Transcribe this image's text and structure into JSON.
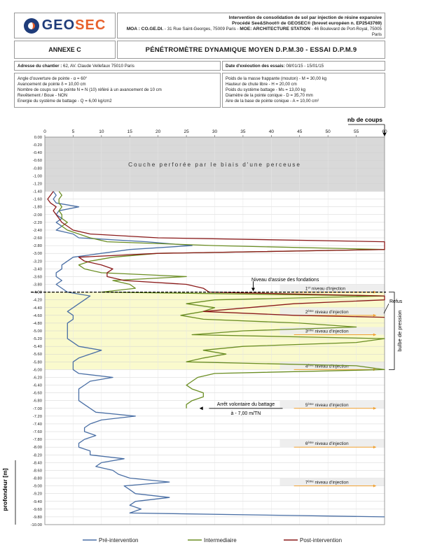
{
  "header": {
    "logo_text_1": "GEO",
    "logo_text_2": "SEC",
    "line1": "Intervention de consolidation de sol par injection de résine expansive",
    "line2": "Procédé See&Shoot® de GEOSEC® (brevet européen n. EP2543769)",
    "moa_label": "MOA : CO.GE.DI.",
    "moa_address": " - 31 Rue Saint-Georges, 75009 Paris - ",
    "moe_label": "MOE: ARCHITECTURE STATION",
    "moe_address": " - 46 Boulevard de Port-Royal, 75005 Paris"
  },
  "annexe": "ANNEXE C",
  "title": "PÉNÉTROMÈTRE DYNAMIQUE MOYEN D.P.M.30 - ESSAI D.P.M.9",
  "address_label": "Adresse du chantier :",
  "address_value": " 62, AV. Claude Vellefaux 75010 Paris",
  "date_label": "Date d'exéoution des essais:",
  "date_value": " 08/01/15 - 15/01/15",
  "params_left": [
    "Angle d'ouverture de pointe - α = 60°",
    "Avancement de pointe δ = 10,00 cm",
    "Nombre de coups sur la pointe N = N (10) référé à un avancement de 10 cm",
    "Revêtement / Boue - NON",
    "Energie du système de battage - Q = 6,00 kg/cm2"
  ],
  "params_right": [
    "Poids de la masse frappante (mouton) - M = 30,00 kg",
    "Hauteur de chute libre - H = 20,00 cm",
    "Poids du système battage - Ms = 13,00 kg",
    "Diamètre de la pointe conique - D = 35,70 mm",
    "Aire de la base de pointe conique - A = 10,00 cm²"
  ],
  "colors": {
    "pre": "#4a6fa5",
    "intermediaire": "#6b8e23",
    "post": "#8b1a1a",
    "zone_gray": "#d9d9d9",
    "bulb": "#fafacd",
    "arrow_orange": "#f0a030"
  },
  "chart_data": {
    "type": "line",
    "orientation": "vertical-depth",
    "xlabel": "nb de coups",
    "ylabel": "profondeur [m]",
    "xlim": [
      0,
      60
    ],
    "ylim": [
      0,
      -10
    ],
    "x_ticks": [
      0,
      5,
      10,
      15,
      20,
      25,
      30,
      35,
      40,
      45,
      50,
      55,
      60
    ],
    "y_ticks": [
      "0.00",
      "-0.20",
      "-0.40",
      "-0.60",
      "-0.80",
      "-1.00",
      "-1.20",
      "-1.40",
      "-1.60",
      "-1.80",
      "-2.00",
      "-2.20",
      "-2.40",
      "-2.60",
      "-2.80",
      "-3.00",
      "-3.20",
      "-3.40",
      "-3.60",
      "-3.80",
      "-4.00",
      "-4.20",
      "-4.40",
      "-4.60",
      "-4.80",
      "-5.00",
      "-5.20",
      "-5.40",
      "-5.60",
      "-5.80",
      "-6.00",
      "-6.20",
      "-6.40",
      "-6.60",
      "-6.80",
      "-7.00",
      "-7.20",
      "-7.40",
      "-7.60",
      "-7.80",
      "-8.00",
      "-8.20",
      "-8.40",
      "-8.60",
      "-8.80",
      "-9.00",
      "-9.20",
      "-9.40",
      "-9.60",
      "-9.80",
      "-10.00"
    ],
    "grid": true,
    "legend_position": "bottom",
    "perforated_zone": {
      "from": 0,
      "to": -1.4,
      "label": "Couche perforée par le biais d'une perceuse"
    },
    "bulb_zone": {
      "from": -4.0,
      "to": -6.0,
      "label": "bulbe de pression"
    },
    "foundation": {
      "depth": -4.0,
      "label": "Niveau d'assise des fondations"
    },
    "refus_label": "Refus",
    "stop_annotation": {
      "line1": "Arrêt volontaire du battage",
      "line2": "à - 7,00 m/TN",
      "depth": -7.0
    },
    "injection_levels": [
      {
        "sup": "1",
        "suffix": "er",
        "text": " niveau d'injection",
        "depth": -4.0
      },
      {
        "sup": "2",
        "suffix": "ème",
        "text": " niveau d'injection",
        "depth": -4.6
      },
      {
        "sup": "3",
        "suffix": "ème",
        "text": " niveau d'injection",
        "depth": -5.1
      },
      {
        "sup": "4",
        "suffix": "ème",
        "text": " niveau d'injection",
        "depth": -6.0
      },
      {
        "sup": "5",
        "suffix": "ème",
        "text": " niveau d'injection",
        "depth": -7.0
      },
      {
        "sup": "6",
        "suffix": "ème",
        "text": " niveau d'injection",
        "depth": -8.0
      },
      {
        "sup": "7",
        "suffix": "ème",
        "text": " niveau d'injection",
        "depth": -9.0
      }
    ],
    "series": [
      {
        "name": "Pré-intervention",
        "points": [
          [
            1.5,
            -1.4
          ],
          [
            2,
            -1.5
          ],
          [
            1.5,
            -1.6
          ],
          [
            2,
            -1.7
          ],
          [
            6,
            -1.8
          ],
          [
            2.5,
            -1.9
          ],
          [
            2,
            -2.0
          ],
          [
            3,
            -2.1
          ],
          [
            2,
            -2.2
          ],
          [
            3,
            -2.3
          ],
          [
            2,
            -2.4
          ],
          [
            5,
            -2.5
          ],
          [
            6,
            -2.6
          ],
          [
            18,
            -2.7
          ],
          [
            26,
            -2.8
          ],
          [
            15,
            -2.9
          ],
          [
            10,
            -3.0
          ],
          [
            5,
            -3.1
          ],
          [
            4,
            -3.2
          ],
          [
            3,
            -3.3
          ],
          [
            3,
            -3.4
          ],
          [
            2,
            -3.5
          ],
          [
            2,
            -3.6
          ],
          [
            3,
            -3.7
          ],
          [
            2,
            -3.8
          ],
          [
            3,
            -3.9
          ],
          [
            4,
            -4.0
          ],
          [
            8,
            -4.1
          ],
          [
            7,
            -4.2
          ],
          [
            6,
            -4.3
          ],
          [
            5,
            -4.4
          ],
          [
            4,
            -4.5
          ],
          [
            5,
            -4.6
          ],
          [
            5,
            -4.7
          ],
          [
            4,
            -4.8
          ],
          [
            4,
            -4.9
          ],
          [
            4,
            -5.0
          ],
          [
            4,
            -5.1
          ],
          [
            4,
            -5.2
          ],
          [
            5,
            -5.3
          ],
          [
            6,
            -5.4
          ],
          [
            10,
            -5.5
          ],
          [
            8,
            -5.6
          ],
          [
            6,
            -5.7
          ],
          [
            5,
            -5.8
          ],
          [
            5,
            -5.9
          ],
          [
            5,
            -6.0
          ],
          [
            6,
            -6.1
          ],
          [
            12,
            -6.2
          ],
          [
            8,
            -6.3
          ],
          [
            7,
            -6.4
          ],
          [
            6,
            -6.5
          ],
          [
            6,
            -6.6
          ],
          [
            6,
            -6.7
          ],
          [
            6,
            -6.8
          ],
          [
            7,
            -6.9
          ],
          [
            8,
            -7.0
          ],
          [
            9,
            -7.1
          ],
          [
            16,
            -7.2
          ],
          [
            10,
            -7.3
          ],
          [
            8,
            -7.4
          ],
          [
            7,
            -7.5
          ],
          [
            7,
            -7.6
          ],
          [
            9,
            -7.7
          ],
          [
            7,
            -7.8
          ],
          [
            6,
            -7.9
          ],
          [
            6,
            -8.0
          ],
          [
            8,
            -8.1
          ],
          [
            8,
            -8.2
          ],
          [
            14,
            -8.3
          ],
          [
            10,
            -8.4
          ],
          [
            9,
            -8.5
          ],
          [
            12,
            -8.6
          ],
          [
            13,
            -8.7
          ],
          [
            15,
            -8.8
          ],
          [
            22,
            -8.9
          ],
          [
            14,
            -9.0
          ],
          [
            15,
            -9.1
          ],
          [
            16,
            -9.2
          ],
          [
            22,
            -9.3
          ],
          [
            16,
            -9.4
          ],
          [
            15,
            -9.5
          ],
          [
            17,
            -9.6
          ],
          [
            15,
            -9.7
          ],
          [
            60,
            -9.8
          ]
        ]
      },
      {
        "name": "Intermediaire",
        "points": [
          [
            2.5,
            -1.4
          ],
          [
            3,
            -1.5
          ],
          [
            2.5,
            -1.6
          ],
          [
            2.5,
            -1.7
          ],
          [
            3,
            -1.8
          ],
          [
            2.5,
            -1.9
          ],
          [
            3,
            -2.0
          ],
          [
            3,
            -2.1
          ],
          [
            4,
            -2.2
          ],
          [
            3,
            -2.3
          ],
          [
            4,
            -2.4
          ],
          [
            6,
            -2.5
          ],
          [
            8,
            -2.6
          ],
          [
            11,
            -2.7
          ],
          [
            30,
            -2.8
          ],
          [
            60,
            -2.9
          ],
          [
            20,
            -3.0
          ],
          [
            12,
            -3.1
          ],
          [
            8,
            -3.2
          ],
          [
            6,
            -3.3
          ],
          [
            7,
            -3.4
          ],
          [
            10,
            -3.5
          ],
          [
            25,
            -3.6
          ],
          [
            12,
            -3.7
          ],
          [
            15,
            -3.8
          ],
          [
            16,
            -3.9
          ],
          [
            10,
            -4.0
          ],
          [
            60,
            -4.1
          ],
          [
            30,
            -4.2
          ],
          [
            25,
            -4.3
          ],
          [
            30,
            -4.4
          ],
          [
            28,
            -4.5
          ],
          [
            24,
            -4.6
          ],
          [
            28,
            -4.7
          ],
          [
            45,
            -4.8
          ],
          [
            55,
            -4.9
          ],
          [
            35,
            -5.0
          ],
          [
            26,
            -5.1
          ],
          [
            60,
            -5.2
          ],
          [
            55,
            -5.3
          ],
          [
            35,
            -5.4
          ],
          [
            28,
            -5.5
          ],
          [
            32,
            -5.6
          ],
          [
            28,
            -5.7
          ],
          [
            25,
            -5.8
          ],
          [
            55,
            -5.9
          ],
          [
            60,
            -6.0
          ],
          [
            30,
            -6.1
          ],
          [
            27,
            -6.2
          ],
          [
            26,
            -6.3
          ],
          [
            25,
            -6.4
          ],
          [
            26,
            -6.5
          ],
          [
            28,
            -6.6
          ],
          [
            28,
            -6.7
          ],
          [
            26,
            -6.8
          ],
          [
            25,
            -6.9
          ],
          [
            25,
            -7.0
          ]
        ]
      },
      {
        "name": "Post-intervention",
        "points": [
          [
            1.5,
            -1.4
          ],
          [
            1,
            -1.5
          ],
          [
            0.5,
            -1.6
          ],
          [
            1,
            -1.7
          ],
          [
            2,
            -1.8
          ],
          [
            1.5,
            -1.9
          ],
          [
            2,
            -2.0
          ],
          [
            2.5,
            -2.1
          ],
          [
            3,
            -2.2
          ],
          [
            4,
            -2.3
          ],
          [
            5,
            -2.4
          ],
          [
            8,
            -2.5
          ],
          [
            20,
            -2.6
          ],
          [
            60,
            -2.7
          ],
          [
            60,
            -2.8
          ],
          [
            60,
            -2.9
          ],
          [
            20,
            -3.0
          ],
          [
            6,
            -3.1
          ],
          [
            7,
            -3.2
          ],
          [
            10,
            -3.3
          ],
          [
            12,
            -3.4
          ],
          [
            11,
            -3.5
          ],
          [
            11,
            -3.6
          ],
          [
            14,
            -3.7
          ],
          [
            25,
            -3.8
          ],
          [
            28,
            -3.9
          ],
          [
            29,
            -4.0
          ],
          [
            60,
            -4.1
          ],
          [
            60,
            -4.2
          ],
          [
            44,
            -4.3
          ],
          [
            36,
            -4.4
          ],
          [
            28,
            -4.5
          ],
          [
            44,
            -4.6
          ],
          [
            60,
            -4.65
          ]
        ]
      }
    ]
  }
}
